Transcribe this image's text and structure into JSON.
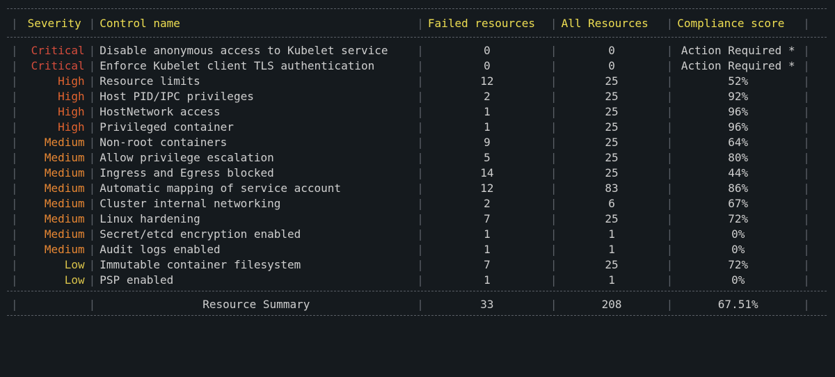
{
  "headers": {
    "severity": "Severity",
    "control_name": "Control name",
    "failed": "Failed resources",
    "all": "All Resources",
    "compliance": "Compliance score"
  },
  "rows": [
    {
      "severity": "Critical",
      "sev_class": "critical",
      "name": "Disable anonymous access to Kubelet service",
      "failed": "0",
      "all": "0",
      "compliance": "Action Required *"
    },
    {
      "severity": "Critical",
      "sev_class": "critical",
      "name": "Enforce Kubelet client TLS authentication",
      "failed": "0",
      "all": "0",
      "compliance": "Action Required *"
    },
    {
      "severity": "High",
      "sev_class": "high",
      "name": "Resource limits",
      "failed": "12",
      "all": "25",
      "compliance": "52%"
    },
    {
      "severity": "High",
      "sev_class": "high",
      "name": "Host PID/IPC privileges",
      "failed": "2",
      "all": "25",
      "compliance": "92%"
    },
    {
      "severity": "High",
      "sev_class": "high",
      "name": "HostNetwork access",
      "failed": "1",
      "all": "25",
      "compliance": "96%"
    },
    {
      "severity": "High",
      "sev_class": "high",
      "name": "Privileged container",
      "failed": "1",
      "all": "25",
      "compliance": "96%"
    },
    {
      "severity": "Medium",
      "sev_class": "medium",
      "name": "Non-root containers",
      "failed": "9",
      "all": "25",
      "compliance": "64%"
    },
    {
      "severity": "Medium",
      "sev_class": "medium",
      "name": "Allow privilege escalation",
      "failed": "5",
      "all": "25",
      "compliance": "80%"
    },
    {
      "severity": "Medium",
      "sev_class": "medium",
      "name": "Ingress and Egress blocked",
      "failed": "14",
      "all": "25",
      "compliance": "44%"
    },
    {
      "severity": "Medium",
      "sev_class": "medium",
      "name": "Automatic mapping of service account",
      "failed": "12",
      "all": "83",
      "compliance": "86%"
    },
    {
      "severity": "Medium",
      "sev_class": "medium",
      "name": "Cluster internal networking",
      "failed": "2",
      "all": "6",
      "compliance": "67%"
    },
    {
      "severity": "Medium",
      "sev_class": "medium",
      "name": "Linux hardening",
      "failed": "7",
      "all": "25",
      "compliance": "72%"
    },
    {
      "severity": "Medium",
      "sev_class": "medium",
      "name": "Secret/etcd encryption enabled",
      "failed": "1",
      "all": "1",
      "compliance": "0%"
    },
    {
      "severity": "Medium",
      "sev_class": "medium",
      "name": "Audit logs enabled",
      "failed": "1",
      "all": "1",
      "compliance": "0%"
    },
    {
      "severity": "Low",
      "sev_class": "low",
      "name": "Immutable container filesystem",
      "failed": "7",
      "all": "25",
      "compliance": "72%"
    },
    {
      "severity": "Low",
      "sev_class": "low",
      "name": "PSP enabled",
      "failed": "1",
      "all": "1",
      "compliance": "0%"
    }
  ],
  "summary": {
    "label": "Resource Summary",
    "failed": "33",
    "all": "208",
    "compliance": "67.51%"
  },
  "chart_data": {
    "type": "table",
    "columns": [
      "Severity",
      "Control name",
      "Failed resources",
      "All Resources",
      "Compliance score"
    ],
    "rows": [
      [
        "Critical",
        "Disable anonymous access to Kubelet service",
        0,
        0,
        "Action Required *"
      ],
      [
        "Critical",
        "Enforce Kubelet client TLS authentication",
        0,
        0,
        "Action Required *"
      ],
      [
        "High",
        "Resource limits",
        12,
        25,
        "52%"
      ],
      [
        "High",
        "Host PID/IPC privileges",
        2,
        25,
        "92%"
      ],
      [
        "High",
        "HostNetwork access",
        1,
        25,
        "96%"
      ],
      [
        "High",
        "Privileged container",
        1,
        25,
        "96%"
      ],
      [
        "Medium",
        "Non-root containers",
        9,
        25,
        "64%"
      ],
      [
        "Medium",
        "Allow privilege escalation",
        5,
        25,
        "80%"
      ],
      [
        "Medium",
        "Ingress and Egress blocked",
        14,
        25,
        "44%"
      ],
      [
        "Medium",
        "Automatic mapping of service account",
        12,
        83,
        "86%"
      ],
      [
        "Medium",
        "Cluster internal networking",
        2,
        6,
        "67%"
      ],
      [
        "Medium",
        "Linux hardening",
        7,
        25,
        "72%"
      ],
      [
        "Medium",
        "Secret/etcd encryption enabled",
        1,
        1,
        "0%"
      ],
      [
        "Medium",
        "Audit logs enabled",
        1,
        1,
        "0%"
      ],
      [
        "Low",
        "Immutable container filesystem",
        7,
        25,
        "72%"
      ],
      [
        "Low",
        "PSP enabled",
        1,
        1,
        "0%"
      ]
    ],
    "summary": {
      "Failed resources": 33,
      "All Resources": 208,
      "Compliance score": "67.51%"
    }
  }
}
